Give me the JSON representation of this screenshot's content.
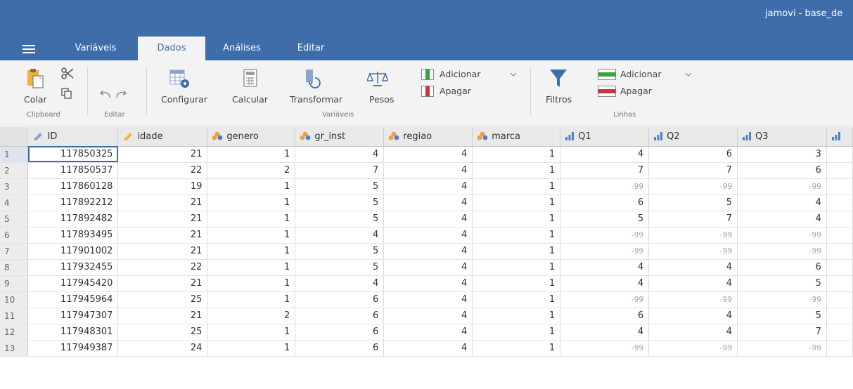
{
  "window": {
    "title": "jamovi - base_de"
  },
  "tabs": [
    {
      "label": "Variáveis"
    },
    {
      "label": "Dados"
    },
    {
      "label": "Análises"
    },
    {
      "label": "Editar"
    }
  ],
  "ribbon": {
    "clipboard": {
      "paste_label": "Colar",
      "group_label": "Clipboard"
    },
    "edit": {
      "group_label": "Editar"
    },
    "variables": {
      "setup_label": "Configurar",
      "compute_label": "Calcular",
      "transform_label": "Transformar",
      "weights_label": "Pesos",
      "add_label": "Adicionar",
      "delete_label": "Apagar",
      "group_label": "Variáveis"
    },
    "rows": {
      "filters_label": "Filtros",
      "add_label": "Adicionar",
      "delete_label": "Apagar",
      "group_label": "Linhas"
    }
  },
  "grid": {
    "columns": [
      {
        "name": "ID",
        "type": "id"
      },
      {
        "name": "idade",
        "type": "continuous"
      },
      {
        "name": "genero",
        "type": "nominal"
      },
      {
        "name": "gr_inst",
        "type": "nominal"
      },
      {
        "name": "regiao",
        "type": "nominal"
      },
      {
        "name": "marca",
        "type": "nominal"
      },
      {
        "name": "Q1",
        "type": "ordinal"
      },
      {
        "name": "Q2",
        "type": "ordinal"
      },
      {
        "name": "Q3",
        "type": "ordinal"
      }
    ],
    "rows": [
      [
        "1",
        "117850325",
        "21",
        "1",
        "4",
        "4",
        "1",
        "4",
        "6",
        "3"
      ],
      [
        "2",
        "117850537",
        "22",
        "2",
        "7",
        "4",
        "1",
        "7",
        "7",
        "6"
      ],
      [
        "3",
        "117860128",
        "19",
        "1",
        "5",
        "4",
        "1",
        "-99",
        "-99",
        "-99"
      ],
      [
        "4",
        "117892212",
        "21",
        "1",
        "5",
        "4",
        "1",
        "6",
        "5",
        "4"
      ],
      [
        "5",
        "117892482",
        "21",
        "1",
        "5",
        "4",
        "1",
        "5",
        "7",
        "4"
      ],
      [
        "6",
        "117893495",
        "21",
        "1",
        "4",
        "4",
        "1",
        "-99",
        "-99",
        "-99"
      ],
      [
        "7",
        "117901002",
        "21",
        "1",
        "5",
        "4",
        "1",
        "-99",
        "-99",
        "-99"
      ],
      [
        "8",
        "117932455",
        "22",
        "1",
        "5",
        "4",
        "1",
        "4",
        "4",
        "6"
      ],
      [
        "9",
        "117945420",
        "21",
        "1",
        "4",
        "4",
        "1",
        "4",
        "4",
        "5"
      ],
      [
        "10",
        "117945964",
        "25",
        "1",
        "6",
        "4",
        "1",
        "-99",
        "-99",
        "-99"
      ],
      [
        "11",
        "117947307",
        "21",
        "2",
        "6",
        "4",
        "1",
        "6",
        "4",
        "5"
      ],
      [
        "12",
        "117948301",
        "25",
        "1",
        "6",
        "4",
        "1",
        "4",
        "4",
        "7"
      ],
      [
        "13",
        "117949387",
        "24",
        "1",
        "6",
        "4",
        "1",
        "-99",
        "-99",
        "-99"
      ]
    ]
  },
  "colors": {
    "accent": "#3e6da9",
    "nominal_icon": "#e8a23c",
    "ordinal_icon": "#4e7fcf",
    "continuous_icon": "#f0b43c",
    "missing_text": "#a3a3a3"
  }
}
